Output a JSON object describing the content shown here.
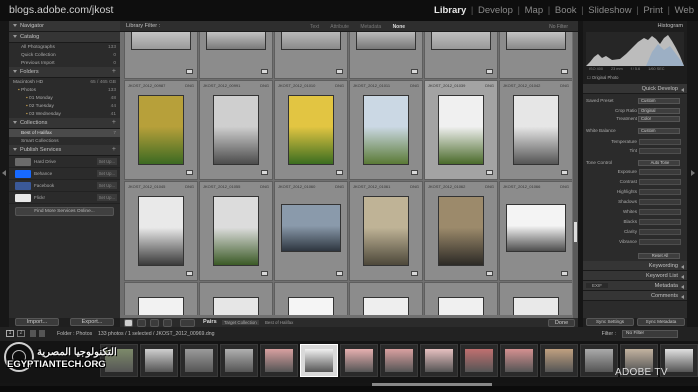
{
  "browser": {
    "url": "blogs.adobe.com/jkost"
  },
  "modules": [
    "Library",
    "Develop",
    "Map",
    "Book",
    "Slideshow",
    "Print",
    "Web"
  ],
  "active_module": "Library",
  "left_panel": {
    "navigator": {
      "title": "Navigator"
    },
    "catalog": {
      "title": "Catalog",
      "items": [
        {
          "label": "All Photographs",
          "count": "133"
        },
        {
          "label": "Quick Collection",
          "count": "0"
        },
        {
          "label": "Previous Import",
          "count": "0"
        }
      ]
    },
    "folders": {
      "title": "Folders",
      "volume": {
        "label": "Macintosh HD",
        "size": "65 / 465 GB"
      },
      "items": [
        {
          "label": "Photos",
          "count": "133"
        },
        {
          "label": "01 Monday",
          "count": "48"
        },
        {
          "label": "02 Tuesday",
          "count": "44"
        },
        {
          "label": "03 Wednesday",
          "count": "41"
        }
      ]
    },
    "collections": {
      "title": "Collections",
      "items": [
        {
          "label": "Best of Halifax",
          "count": "7"
        },
        {
          "label": "Smart Collections",
          "count": ""
        }
      ]
    },
    "publish": {
      "title": "Publish Services",
      "items": [
        {
          "label": "Hard Drive",
          "setup": "Set Up..."
        },
        {
          "label": "Behance",
          "setup": "Set Up..."
        },
        {
          "label": "Facebook",
          "setup": "Set Up..."
        },
        {
          "label": "Flickr",
          "setup": "Set Up..."
        }
      ],
      "find_more": "Find More Services Online..."
    },
    "import_button": "Import...",
    "export_button": "Export..."
  },
  "filter_bar": {
    "title": "Library Filter :",
    "options": [
      "Text",
      "Attribute",
      "Metadata",
      "None"
    ],
    "active_option": "None",
    "right_label": "No Filter"
  },
  "grid": {
    "filenames": [
      "JKOST_2012_00976",
      "JKOST_2012_00977",
      "JKOST_2012_00979",
      "JKOST_2012_00982",
      "JKOST_2012_00984",
      "JKOST_2012_00987",
      "JKOST_2012_00987",
      "JKOST_2012_00991",
      "JKOST_2012_01010",
      "JKOST_2012_01011",
      "JKOST_2012_01039",
      "JKOST_2012_01042",
      "JKOST_2012_01045",
      "JKOST_2012_01055",
      "JKOST_2012_01060",
      "JKOST_2012_01061",
      "JKOST_2012_01062",
      "JKOST_2012_01066"
    ],
    "extension": "DNG"
  },
  "toolbar": {
    "sort_label": "Pairs",
    "target_label": "Target Collection",
    "target_value": "Best of Halifax",
    "done_button": "Done"
  },
  "right_panel": {
    "histogram_title": "Histogram",
    "histogram_values": [
      "ISO 400",
      "23 mm",
      "f / 5.6",
      "1/60 SEC"
    ],
    "original_photo": "Original Photo",
    "quick_develop": {
      "title": "Quick Develop",
      "saved_preset": {
        "label": "Saved Preset",
        "value": "Custom"
      },
      "crop_ratio": {
        "label": "Crop Ratio",
        "value": "Original"
      },
      "treatment": {
        "label": "Treatment",
        "value": "Color"
      },
      "white_balance": {
        "label": "White Balance",
        "value": "Custom"
      },
      "temperature": "Temperature",
      "tint": "Tint",
      "tone_control": {
        "label": "Tone Control",
        "value": "Auto Tone"
      },
      "tone_rows": [
        "Exposure",
        "Contrast",
        "Highlights",
        "Shadows",
        "Whites",
        "Blacks",
        "Clarity",
        "Vibrance"
      ],
      "reset_all": "Reset All"
    },
    "keywording": "Keywording",
    "keyword_list": "Keyword List",
    "metadata": {
      "title": "Metadata",
      "preset": "EXIF"
    },
    "comments": "Comments",
    "sync_settings": "Sync Settings",
    "sync_metadata": "Sync Metadata"
  },
  "filmstrip_bar": {
    "screen1": "1",
    "screen2": "2",
    "source": "Folder : Photos",
    "info": "133 photos / 1 selected / JKOST_2012_00969.dng",
    "filter_label": "Filter :",
    "filter_value": "No Filter"
  },
  "watermark": {
    "logo_arabic": "التكنولوجيا المصرية",
    "logo_english": "EGYPTIANTECH.ORG",
    "adobe_tv": "ADOBE TV"
  }
}
